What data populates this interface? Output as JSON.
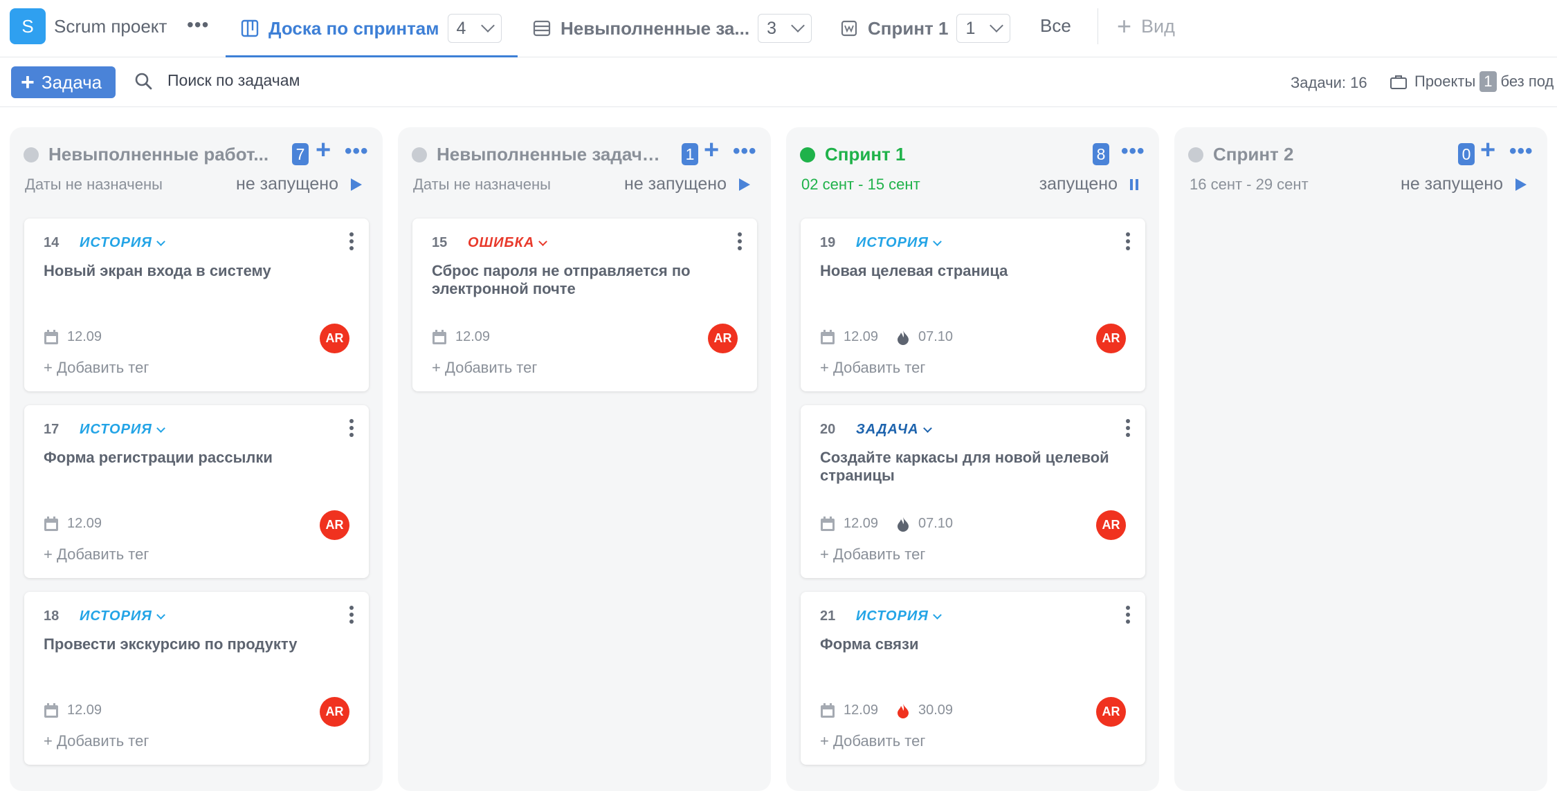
{
  "project": {
    "initial": "S",
    "name": "Scrum проект"
  },
  "tabs": [
    {
      "label": "Доска по спринтам",
      "count": "4",
      "icon": "board-icon",
      "active": true
    },
    {
      "label": "Невыполненные за...",
      "count": "3",
      "icon": "backlog-list-icon",
      "active": false
    },
    {
      "label": "Спринт 1",
      "count": "1",
      "icon": "sprint-icon",
      "active": false
    }
  ],
  "tab_all": "Все",
  "tab_view": "Вид",
  "toolbar": {
    "add_task": "Задача",
    "search_placeholder": "Поиск по задачам",
    "task_count": "Задачи: 16",
    "projects_label": "Проекты",
    "projects_count": "1",
    "projects_suffix": "без под"
  },
  "colors": {
    "accent": "#4a83d8",
    "green": "#1fb24a",
    "story": "#23a4e6",
    "bug": "#e8392b",
    "task": "#1d63ad",
    "avatar": "#f0321f"
  },
  "columns": [
    {
      "title": "Невыполненные работ...",
      "count": "7",
      "dates": "Даты не назначены",
      "status": "не запущено",
      "cards": [
        {
          "num": "14",
          "type": "ИСТОРИЯ",
          "title": "Новый экран входа в систему",
          "due": "12.09",
          "est": "",
          "avatar": "AR",
          "tag": "+ Добавить тег"
        },
        {
          "num": "17",
          "type": "ИСТОРИЯ",
          "title": "Форма регистрации рассылки",
          "due": "12.09",
          "est": "",
          "avatar": "AR",
          "tag": "+ Добавить тег"
        },
        {
          "num": "18",
          "type": "ИСТОРИЯ",
          "title": "Провести экскурсию по продукту",
          "due": "12.09",
          "est": "",
          "avatar": "AR",
          "tag": "+ Добавить тег"
        }
      ]
    },
    {
      "title": "Невыполненные задачи...",
      "count": "1",
      "dates": "Даты не назначены",
      "status": "не запущено",
      "cards": [
        {
          "num": "15",
          "type": "ОШИБКА",
          "title": "Сброс пароля не отправляется по электронной почте",
          "due": "12.09",
          "est": "",
          "avatar": "AR",
          "tag": "+ Добавить тег"
        }
      ]
    },
    {
      "title": "Спринт 1",
      "count": "8",
      "dates": "02 сент - 15 сент",
      "status": "запущено",
      "cards": [
        {
          "num": "19",
          "type": "ИСТОРИЯ",
          "title": "Новая целевая страница",
          "due": "12.09",
          "est": "07.10",
          "avatar": "AR",
          "tag": "+ Добавить тег"
        },
        {
          "num": "20",
          "type": "ЗАДАЧА",
          "title": "Создайте каркасы для новой целевой страницы",
          "due": "12.09",
          "est": "07.10",
          "avatar": "AR",
          "tag": "+ Добавить тег"
        },
        {
          "num": "21",
          "type": "ИСТОРИЯ",
          "title": "Форма связи",
          "due": "12.09",
          "est": "30.09",
          "avatar": "AR",
          "tag": "+ Добавить тег"
        }
      ]
    },
    {
      "title": "Спринт 2",
      "count": "0",
      "dates": "16 сент - 29 сент",
      "status": "не запущено",
      "cards": []
    }
  ]
}
